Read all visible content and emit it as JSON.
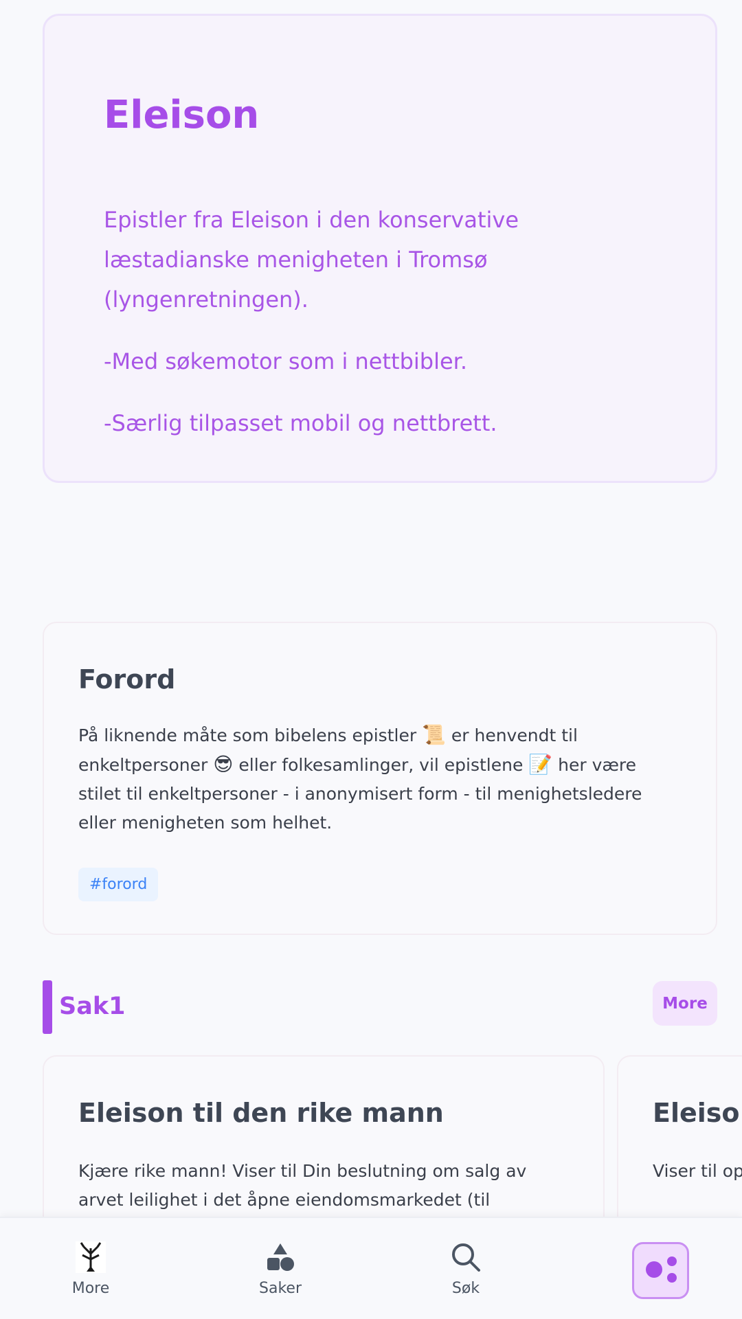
{
  "hero": {
    "title": "Eleison",
    "lines": [
      "Epistler fra Eleison i den konservative læstadianske menigheten i Tromsø (lyngenretningen).",
      "-Med søkemotor som i nettbibler.",
      "-Særlig tilpasset mobil og nettbrett."
    ]
  },
  "forord": {
    "title": "Forord",
    "body_part1": "På liknende måte som bibelens epistler ",
    "emoji1": "📜",
    "body_part2": " er henvendt til enkeltpersoner ",
    "emoji2": "😎",
    "body_part3": " eller folkesamlinger, vil epistlene ",
    "emoji3": "📝",
    "body_part4": " her være stilet til enkeltpersoner - i anonymisert form - til menighetsledere eller menigheten som helhet.",
    "tag": "#forord"
  },
  "section": {
    "title": "Sak1",
    "more_label": "More"
  },
  "cards": [
    {
      "title": "Eleison til den rike mann",
      "body": "Kjære rike mann! Viser til Din beslutning om salg av arvet leilighet i det åpne eiendomsmarkedet (til"
    },
    {
      "title": "Eleiso",
      "body": "Viser til oppforc"
    }
  ],
  "bottom_nav": {
    "items": [
      {
        "label": "More",
        "icon": "tree-icon"
      },
      {
        "label": "Saker",
        "icon": "shapes-icon"
      },
      {
        "label": "Søk",
        "icon": "search-icon"
      },
      {
        "label": "",
        "icon": "dots-icon",
        "active": true
      }
    ]
  },
  "colors": {
    "accent": "#a64de8",
    "tag_blue": "#3b82f6"
  }
}
